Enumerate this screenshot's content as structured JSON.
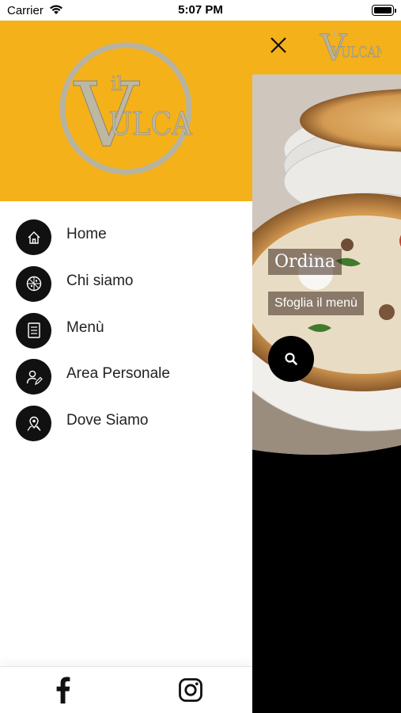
{
  "status_bar": {
    "carrier": "Carrier",
    "time": "5:07 PM"
  },
  "brand": {
    "logo_text_small": "il",
    "logo_text_main": "VULCANO",
    "color": "#F5B11A"
  },
  "menu": {
    "items": [
      {
        "label": "Home",
        "icon": "home-icon"
      },
      {
        "label": "Chi siamo",
        "icon": "pizza-icon"
      },
      {
        "label": "Menù",
        "icon": "menu-book-icon"
      },
      {
        "label": "Area Personale",
        "icon": "user-edit-icon"
      },
      {
        "label": "Dove Siamo",
        "icon": "map-pin-icon"
      }
    ]
  },
  "footer": {
    "social": [
      "facebook-icon",
      "instagram-icon"
    ]
  },
  "main": {
    "order_title": "Ordina",
    "browse_menu": "Sfoglia il menù"
  }
}
